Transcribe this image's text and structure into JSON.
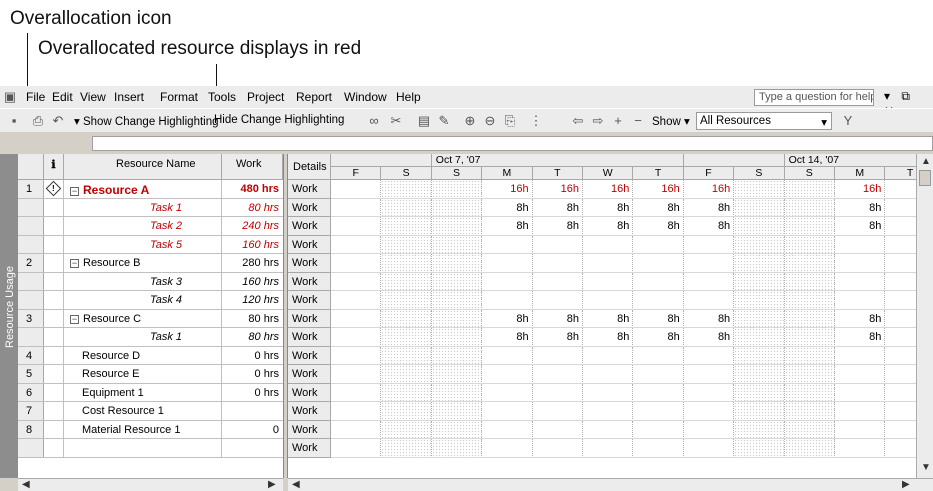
{
  "callouts": {
    "icon_label": "Overallocation icon",
    "resource_label": "Overallocated resource displays in red"
  },
  "menu": {
    "items": [
      "File",
      "Edit",
      "View",
      "Insert",
      "Format",
      "Tools",
      "Project",
      "Report",
      "Window",
      "Help"
    ],
    "help_placeholder": "Type a question for help",
    "window_controls": "▾ ⧉ ✕"
  },
  "toolbar": {
    "show_change_highlighting": "Show Change Highlighting",
    "hide_change_highlighting": "Hide Change Highlighting",
    "show_label": "Show",
    "filter_value": "All Resources",
    "icons": [
      "save-icon",
      "print-icon",
      "undo-icon",
      "link-icon",
      "unlink-icon",
      "info-icon",
      "notes-icon",
      "zoom-in-icon",
      "zoom-out-icon",
      "copy-picture-icon",
      "scroll-to-task-icon",
      "arrow-left-icon",
      "arrow-right-icon",
      "add-icon",
      "remove-icon",
      "autofilter-icon"
    ]
  },
  "view_bar": {
    "label": "Resource Usage"
  },
  "left_headers": {
    "info": "ℹ",
    "resource_name": "Resource Name",
    "work": "Work"
  },
  "rows": [
    {
      "id": "1",
      "name": "Resource A",
      "work": "480 hrs",
      "kind": "resource",
      "overallocated": true,
      "icon": "overallocation-icon"
    },
    {
      "id": "",
      "name": "Task 1",
      "work": "80 hrs",
      "kind": "task",
      "overallocated": true
    },
    {
      "id": "",
      "name": "Task 2",
      "work": "240 hrs",
      "kind": "task",
      "overallocated": true
    },
    {
      "id": "",
      "name": "Task 5",
      "work": "160 hrs",
      "kind": "task",
      "overallocated": true
    },
    {
      "id": "2",
      "name": "Resource B",
      "work": "280 hrs",
      "kind": "resource",
      "overallocated": false
    },
    {
      "id": "",
      "name": "Task 3",
      "work": "160 hrs",
      "kind": "task",
      "overallocated": false
    },
    {
      "id": "",
      "name": "Task 4",
      "work": "120 hrs",
      "kind": "task",
      "overallocated": false
    },
    {
      "id": "3",
      "name": "Resource C",
      "work": "80 hrs",
      "kind": "resource",
      "overallocated": false
    },
    {
      "id": "",
      "name": "Task 1",
      "work": "80 hrs",
      "kind": "task",
      "overallocated": false
    },
    {
      "id": "4",
      "name": "Resource D",
      "work": "0 hrs",
      "kind": "plain",
      "overallocated": false
    },
    {
      "id": "5",
      "name": "Resource E",
      "work": "0 hrs",
      "kind": "plain",
      "overallocated": false
    },
    {
      "id": "6",
      "name": "Equipment 1",
      "work": "0 hrs",
      "kind": "plain",
      "overallocated": false
    },
    {
      "id": "7",
      "name": "Cost Resource 1",
      "work": "",
      "kind": "plain",
      "overallocated": false
    },
    {
      "id": "8",
      "name": "Material Resource 1",
      "work": "0",
      "kind": "plain",
      "overallocated": false
    },
    {
      "id": "",
      "name": "",
      "work": "",
      "kind": "blank",
      "overallocated": false
    }
  ],
  "timescale": {
    "details_label": "Details",
    "weeks": [
      "Oct 7, '07",
      "Oct 14, '07"
    ],
    "days": [
      "F",
      "S",
      "S",
      "M",
      "T",
      "W",
      "T",
      "F",
      "S",
      "S",
      "M",
      "T"
    ],
    "weekend_cols": [
      1,
      2,
      8,
      9
    ],
    "row_label": "Work",
    "values": [
      [
        "",
        "",
        "",
        "16h",
        "16h",
        "16h",
        "16h",
        "16h",
        "",
        "",
        "16h",
        ""
      ],
      [
        "",
        "",
        "",
        "8h",
        "8h",
        "8h",
        "8h",
        "8h",
        "",
        "",
        "8h",
        ""
      ],
      [
        "",
        "",
        "",
        "8h",
        "8h",
        "8h",
        "8h",
        "8h",
        "",
        "",
        "8h",
        ""
      ],
      [
        "",
        "",
        "",
        "",
        "",
        "",
        "",
        "",
        "",
        "",
        "",
        ""
      ],
      [
        "",
        "",
        "",
        "",
        "",
        "",
        "",
        "",
        "",
        "",
        "",
        ""
      ],
      [
        "",
        "",
        "",
        "",
        "",
        "",
        "",
        "",
        "",
        "",
        "",
        ""
      ],
      [
        "",
        "",
        "",
        "",
        "",
        "",
        "",
        "",
        "",
        "",
        "",
        ""
      ],
      [
        "",
        "",
        "",
        "8h",
        "8h",
        "8h",
        "8h",
        "8h",
        "",
        "",
        "8h",
        ""
      ],
      [
        "",
        "",
        "",
        "8h",
        "8h",
        "8h",
        "8h",
        "8h",
        "",
        "",
        "8h",
        ""
      ],
      [
        "",
        "",
        "",
        "",
        "",
        "",
        "",
        "",
        "",
        "",
        "",
        ""
      ],
      [
        "",
        "",
        "",
        "",
        "",
        "",
        "",
        "",
        "",
        "",
        "",
        ""
      ],
      [
        "",
        "",
        "",
        "",
        "",
        "",
        "",
        "",
        "",
        "",
        "",
        ""
      ],
      [
        "",
        "",
        "",
        "",
        "",
        "",
        "",
        "",
        "",
        "",
        "",
        ""
      ],
      [
        "",
        "",
        "",
        "",
        "",
        "",
        "",
        "",
        "",
        "",
        "",
        ""
      ],
      [
        "",
        "",
        "",
        "",
        "",
        "",
        "",
        "",
        "",
        "",
        "",
        ""
      ]
    ],
    "overallocated_values": [
      true,
      false,
      false,
      false,
      false,
      false,
      false,
      false,
      false,
      false,
      false,
      false,
      false,
      false,
      false
    ]
  },
  "colors": {
    "overallocated": "#c00000",
    "header_bg": "#ececec",
    "viewbar": "#8d8d8d"
  }
}
